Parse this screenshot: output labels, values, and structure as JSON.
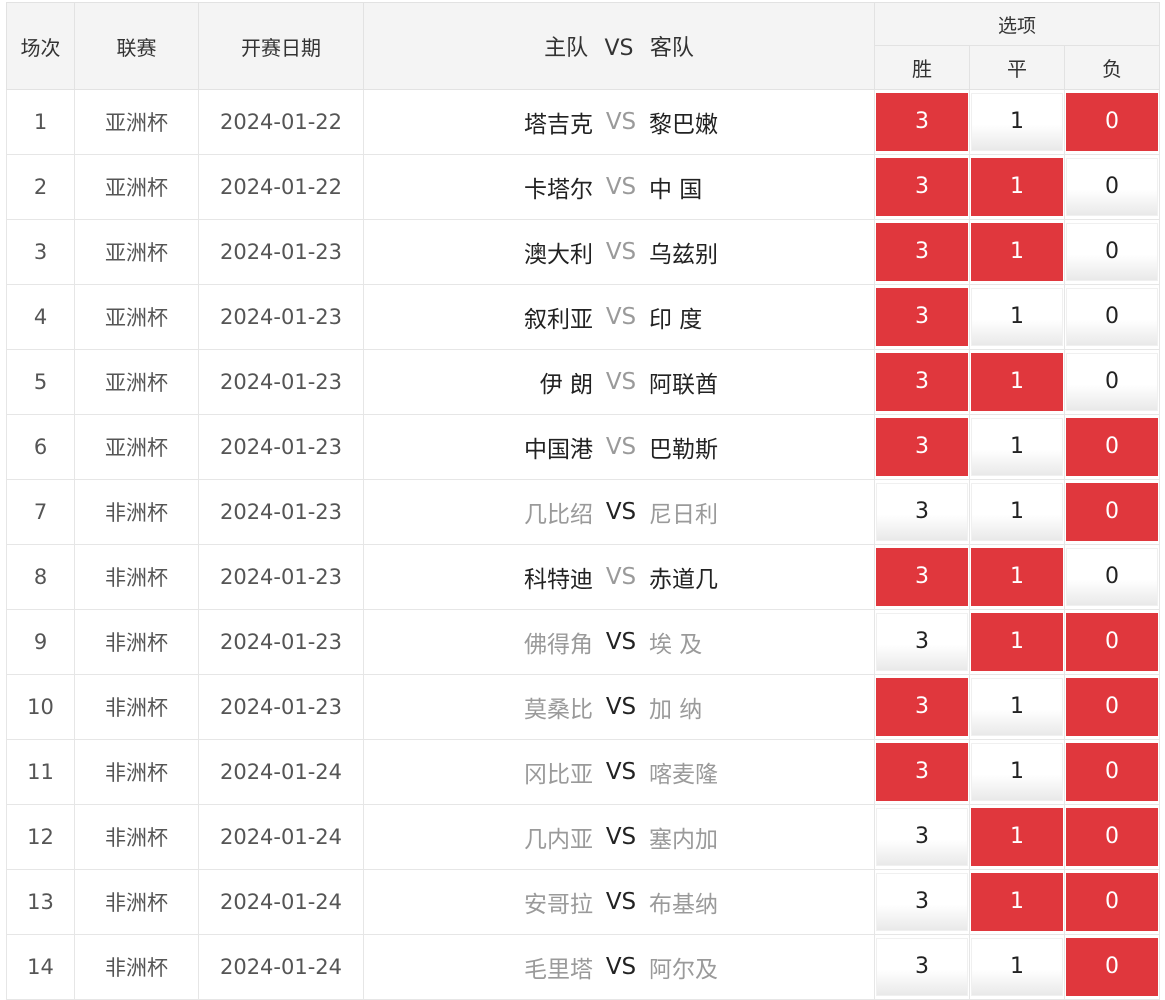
{
  "headers": {
    "no": "场次",
    "league": "联赛",
    "date": "开赛日期",
    "home": "主队",
    "vs": "VS",
    "away": "客队",
    "options": "选项",
    "win": "胜",
    "draw": "平",
    "lose": "负"
  },
  "colors": {
    "selected": "#e0373d",
    "muted": "#9a9a9a"
  },
  "matches": [
    {
      "no": "1",
      "league": "亚洲杯",
      "date": "2024-01-22",
      "home": "塔吉克",
      "vs": "VS",
      "away": "黎巴嫩",
      "dim": "vs",
      "w": "3",
      "d": "1",
      "l": "0",
      "sel": [
        true,
        false,
        true
      ]
    },
    {
      "no": "2",
      "league": "亚洲杯",
      "date": "2024-01-22",
      "home": "卡塔尔",
      "vs": "VS",
      "away": "中 国",
      "dim": "vs",
      "w": "3",
      "d": "1",
      "l": "0",
      "sel": [
        true,
        true,
        false
      ]
    },
    {
      "no": "3",
      "league": "亚洲杯",
      "date": "2024-01-23",
      "home": "澳大利",
      "vs": "VS",
      "away": "乌兹别",
      "dim": "vs",
      "w": "3",
      "d": "1",
      "l": "0",
      "sel": [
        true,
        true,
        false
      ]
    },
    {
      "no": "4",
      "league": "亚洲杯",
      "date": "2024-01-23",
      "home": "叙利亚",
      "vs": "VS",
      "away": "印 度",
      "dim": "vs",
      "w": "3",
      "d": "1",
      "l": "0",
      "sel": [
        true,
        false,
        false
      ]
    },
    {
      "no": "5",
      "league": "亚洲杯",
      "date": "2024-01-23",
      "home": "伊 朗",
      "vs": "VS",
      "away": "阿联酋",
      "dim": "vs",
      "w": "3",
      "d": "1",
      "l": "0",
      "sel": [
        true,
        true,
        false
      ]
    },
    {
      "no": "6",
      "league": "亚洲杯",
      "date": "2024-01-23",
      "home": "中国港",
      "vs": "VS",
      "away": "巴勒斯",
      "dim": "vs",
      "w": "3",
      "d": "1",
      "l": "0",
      "sel": [
        true,
        false,
        true
      ]
    },
    {
      "no": "7",
      "league": "非洲杯",
      "date": "2024-01-23",
      "home": "几比绍",
      "vs": "VS",
      "away": "尼日利",
      "dim": "teams",
      "w": "3",
      "d": "1",
      "l": "0",
      "sel": [
        false,
        false,
        true
      ]
    },
    {
      "no": "8",
      "league": "非洲杯",
      "date": "2024-01-23",
      "home": "科特迪",
      "vs": "VS",
      "away": "赤道几",
      "dim": "vs",
      "w": "3",
      "d": "1",
      "l": "0",
      "sel": [
        true,
        true,
        false
      ]
    },
    {
      "no": "9",
      "league": "非洲杯",
      "date": "2024-01-23",
      "home": "佛得角",
      "vs": "VS",
      "away": "埃 及",
      "dim": "teams",
      "w": "3",
      "d": "1",
      "l": "0",
      "sel": [
        false,
        true,
        true
      ]
    },
    {
      "no": "10",
      "league": "非洲杯",
      "date": "2024-01-23",
      "home": "莫桑比",
      "vs": "VS",
      "away": "加 纳",
      "dim": "teams",
      "w": "3",
      "d": "1",
      "l": "0",
      "sel": [
        true,
        false,
        true
      ]
    },
    {
      "no": "11",
      "league": "非洲杯",
      "date": "2024-01-24",
      "home": "冈比亚",
      "vs": "VS",
      "away": "喀麦隆",
      "dim": "teams",
      "w": "3",
      "d": "1",
      "l": "0",
      "sel": [
        true,
        false,
        true
      ]
    },
    {
      "no": "12",
      "league": "非洲杯",
      "date": "2024-01-24",
      "home": "几内亚",
      "vs": "VS",
      "away": "塞内加",
      "dim": "teams",
      "w": "3",
      "d": "1",
      "l": "0",
      "sel": [
        false,
        true,
        true
      ]
    },
    {
      "no": "13",
      "league": "非洲杯",
      "date": "2024-01-24",
      "home": "安哥拉",
      "vs": "VS",
      "away": "布基纳",
      "dim": "teams",
      "w": "3",
      "d": "1",
      "l": "0",
      "sel": [
        false,
        true,
        true
      ]
    },
    {
      "no": "14",
      "league": "非洲杯",
      "date": "2024-01-24",
      "home": "毛里塔",
      "vs": "VS",
      "away": "阿尔及",
      "dim": "teams",
      "w": "3",
      "d": "1",
      "l": "0",
      "sel": [
        false,
        false,
        true
      ]
    }
  ]
}
